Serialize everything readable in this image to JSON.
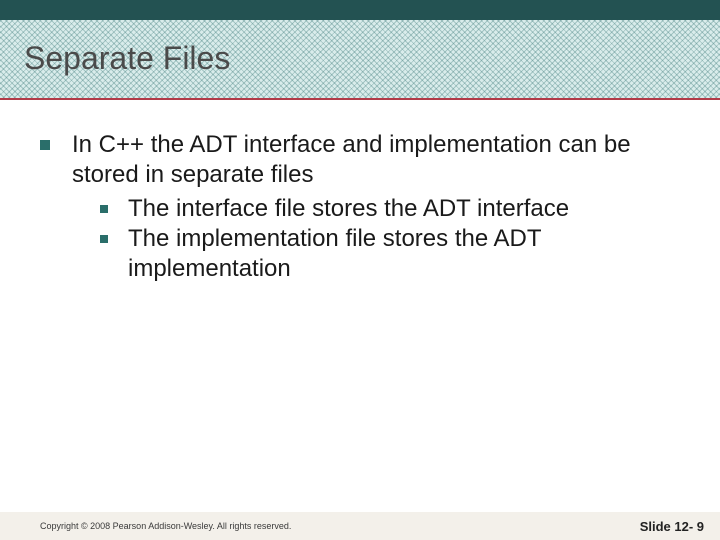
{
  "title": "Separate Files",
  "bullets": {
    "main": "In C++ the ADT interface and implementation can be stored in separate files",
    "sub1": "The interface file stores the ADT interface",
    "sub2": "The implementation file stores the ADT implementation"
  },
  "footer": {
    "copyright": "Copyright © 2008 Pearson Addison-Wesley. All rights reserved.",
    "slide": "Slide 12- 9"
  }
}
